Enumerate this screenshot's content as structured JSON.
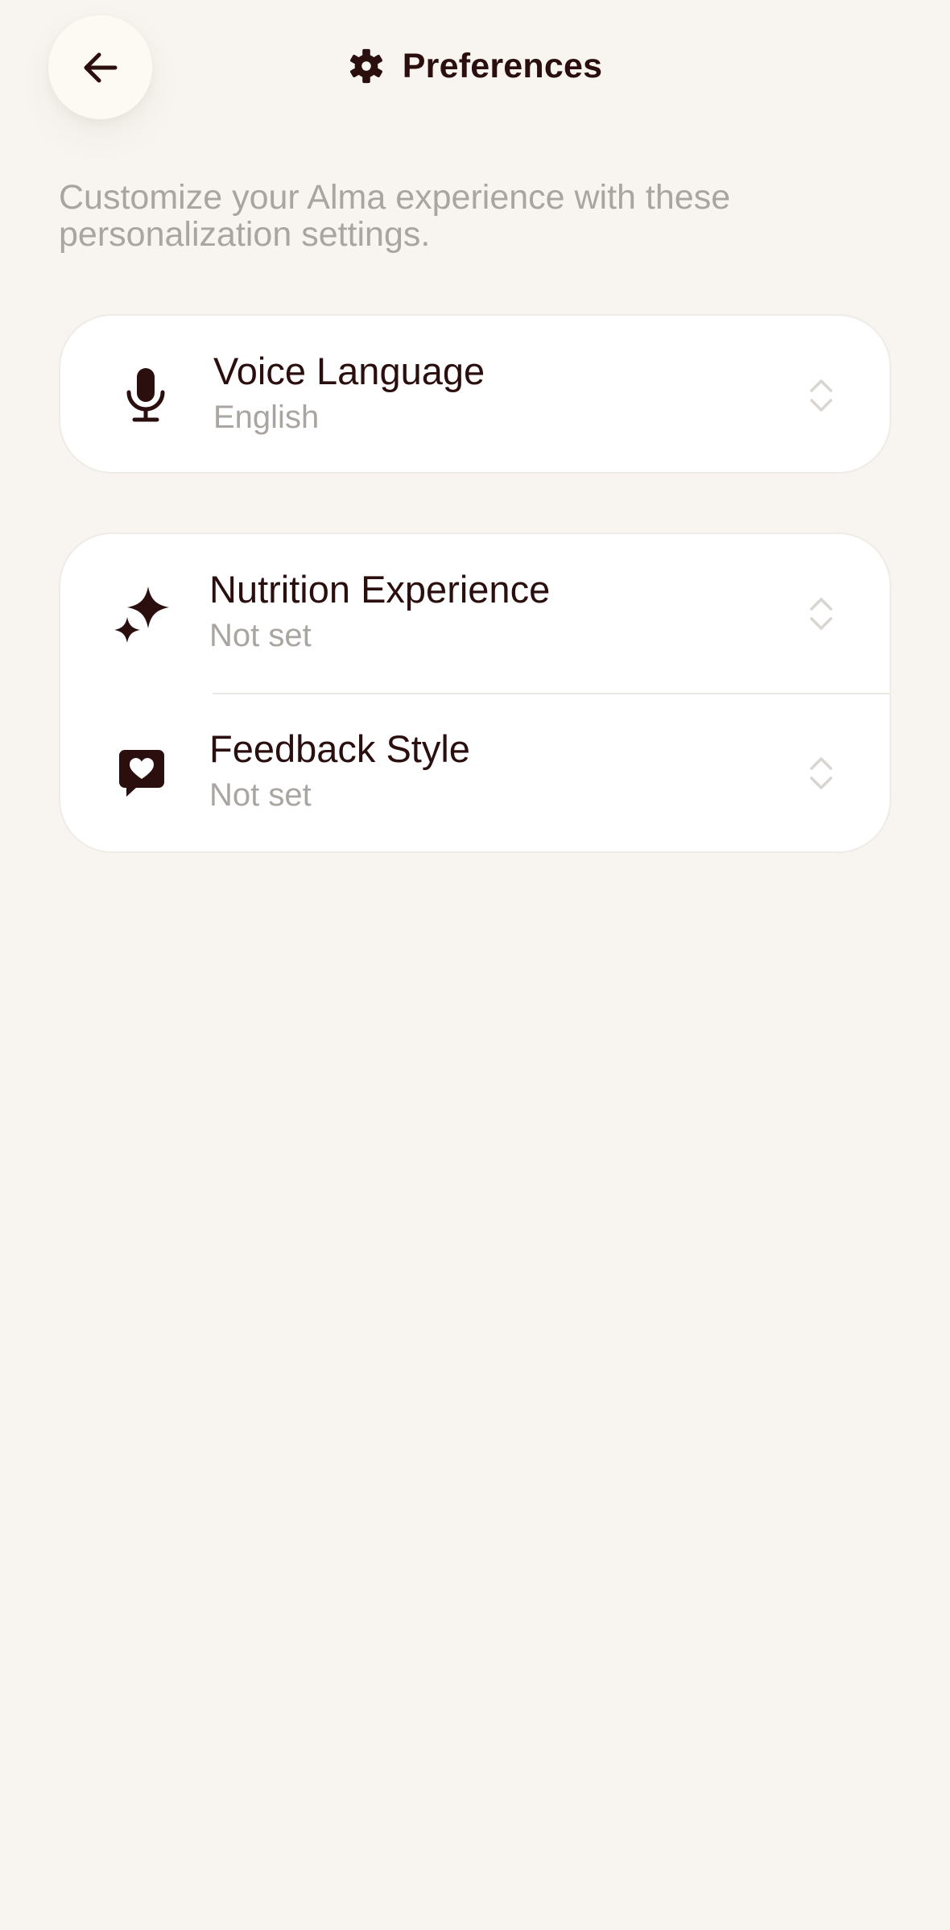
{
  "header": {
    "title": "Preferences",
    "back_icon": "arrow-left-icon",
    "title_icon": "gear-icon"
  },
  "subtitle": "Customize your Alma experience with these personalization settings.",
  "settings": {
    "voice_language": {
      "label": "Voice Language",
      "value": "English",
      "icon": "microphone-icon"
    },
    "nutrition_experience": {
      "label": "Nutrition Experience",
      "value": "Not set",
      "icon": "sparkles-icon"
    },
    "feedback_style": {
      "label": "Feedback Style",
      "value": "Not set",
      "icon": "chat-heart-icon"
    }
  },
  "colors": {
    "background": "#f8f5f0",
    "card": "#ffffff",
    "text_primary": "#2b0f0f",
    "text_secondary": "#a9a5a1"
  }
}
